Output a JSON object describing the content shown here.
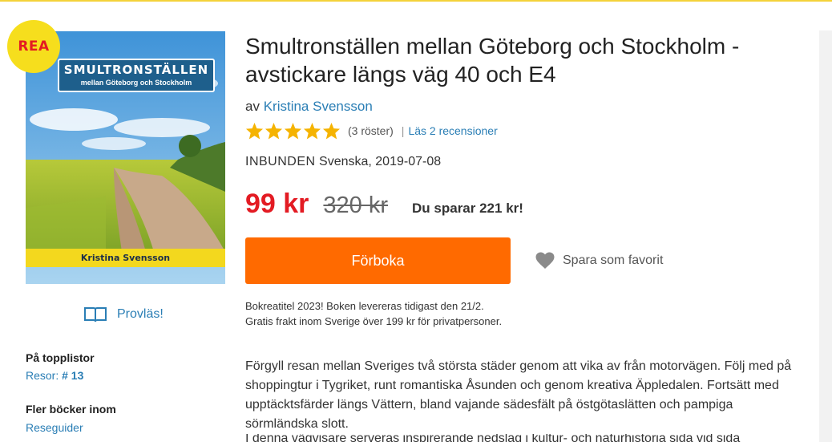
{
  "badge": {
    "label": "REA"
  },
  "cover": {
    "title": "SMULTRONSTÄLLEN",
    "subtitle": "mellan Göteborg och Stockholm",
    "author": "Kristina Svensson"
  },
  "preview": {
    "label": "Provläs!",
    "icon": "open-book-icon"
  },
  "sidebar": {
    "toplists_heading": "På topplistor",
    "toplist_category": "Resor:",
    "toplist_rank": "# 13",
    "more_books_heading": "Fler böcker inom",
    "more_books_link": "Reseguider"
  },
  "product": {
    "title": "Smultronställen mellan Göteborg och Stockholm - avstickare längs väg 40 och E4",
    "by_prefix": "av",
    "author": "Kristina Svensson",
    "rating": 5,
    "rating_max": 5,
    "rating_count": "(3 röster)",
    "reviews_separator": "|",
    "reviews_link": "Läs 2 recensioner",
    "format": "INBUNDEN",
    "language_date": "Svenska, 2019-07-08",
    "price": "99 kr",
    "old_price": "320 kr",
    "savings": "Du sparar 221 kr!",
    "preorder_label": "Förboka",
    "favorite_label": "Spara som favorit",
    "favorite_icon": "heart-icon",
    "delivery_line1": "Bokreatitel 2023! Boken levereras tidigast den 21/2.",
    "delivery_line2": "Gratis frakt inom Sverige över 199 kr för privatpersoner.",
    "description": "Förgyll resan mellan Sveriges två största städer genom att vika av från motorvägen. Följ med på shoppingtur i Tygriket, runt romantiska Åsunden och genom kreativa Äppledalen. Fortsätt med upptäcktsfärder längs Vättern, bland vajande sädesfält på östgötaslätten och pampiga sörmländska slott.",
    "description_cutoff": "I denna vägvisare serveras inspirerande nedslag i kultur- och naturhistoria sida vid sida"
  },
  "colors": {
    "accent_orange": "#ff6a00",
    "price_red": "#e31b23",
    "link_blue": "#2a7eb5",
    "star_gold": "#f5b301",
    "badge_yellow": "#f6de1d"
  }
}
